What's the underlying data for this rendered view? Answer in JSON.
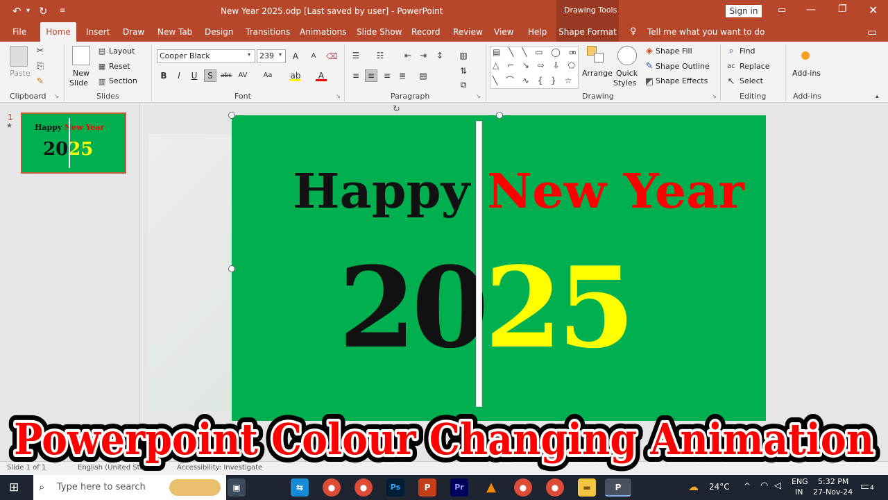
{
  "titlebar": {
    "title": "New Year 2025.odp [Last saved by user]  -  PowerPoint",
    "contextual": "Drawing Tools",
    "signin": "Sign in"
  },
  "tabs": [
    "File",
    "Home",
    "Insert",
    "Draw",
    "New Tab",
    "Design",
    "Transitions",
    "Animations",
    "Slide Show",
    "Record",
    "Review",
    "View",
    "Help",
    "Shape Format"
  ],
  "tell_me": "Tell me what you want to do",
  "ribbon": {
    "clipboard": {
      "label": "Clipboard",
      "paste": "Paste"
    },
    "slides": {
      "label": "Slides",
      "new_slide": "New",
      "new_slide2": "Slide",
      "layout": "Layout",
      "reset": "Reset",
      "section": "Section"
    },
    "font": {
      "label": "Font",
      "name": "Cooper Black",
      "size": "239"
    },
    "paragraph": {
      "label": "Paragraph"
    },
    "drawing": {
      "label": "Drawing",
      "arrange": "Arrange",
      "quick": "Quick",
      "styles": "Styles",
      "shape_fill": "Shape Fill",
      "shape_outline": "Shape Outline",
      "shape_effects": "Shape Effects"
    },
    "editing": {
      "label": "Editing",
      "find": "Find",
      "replace": "Replace",
      "select": "Select"
    },
    "addins": {
      "label": "Add-ins",
      "btn": "Add-ins"
    }
  },
  "thumbnail": {
    "number": "1",
    "star": "★",
    "line1_black": "Happy ",
    "line1_red": "New Year",
    "line2_black": "20",
    "line2_yellow": "25"
  },
  "slide": {
    "happy": "Happy ",
    "new_year": "New Year",
    "year_black": "20",
    "year_yellow": "25"
  },
  "overlay_title": "Powerpoint Colour Changing Animation",
  "statusbar": {
    "left": "Slide 1 of 1",
    "lang": "English (United States)",
    "access": "Accessibility: Investigate"
  },
  "taskbar": {
    "search": "Type here to search",
    "temp": "24°C",
    "lang1": "ENG",
    "lang2": "IN",
    "time": "5:32 PM",
    "date": "27-Nov-24",
    "notif": "4"
  },
  "colors": {
    "accent": "#b7472a",
    "slide_bg": "#00b050",
    "red": "#ff0000",
    "yellow": "#ffff00"
  }
}
